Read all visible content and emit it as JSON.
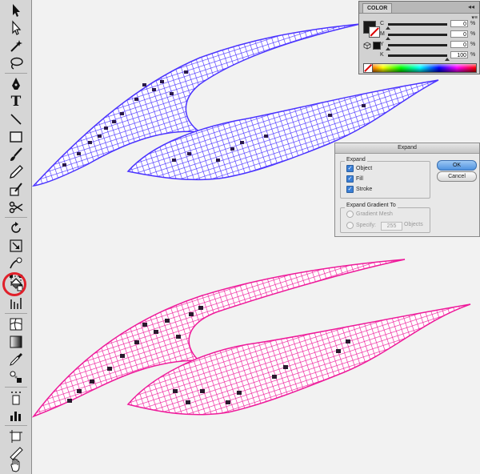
{
  "colors": {
    "mesh_top": "#4a33ff",
    "mesh_bottom": "#ee1a9a",
    "mesh_cell_dark": "#2a1a4a",
    "highlight_circle": "#e0202a"
  },
  "toolbar": {
    "active_tool": "live-paint-bucket",
    "tools": [
      {
        "name": "selection-tool",
        "icon": "arrow-icon"
      },
      {
        "name": "direct-selection-tool",
        "icon": "hollow-arrow-icon"
      },
      {
        "name": "magic-wand-tool",
        "icon": "wand-icon"
      },
      {
        "name": "lasso-tool",
        "icon": "lasso-icon"
      },
      {
        "name": "pen-tool",
        "icon": "pen-icon"
      },
      {
        "name": "type-tool",
        "icon": "type-icon",
        "glyph": "T"
      },
      {
        "name": "line-tool",
        "icon": "line-icon"
      },
      {
        "name": "rectangle-tool",
        "icon": "rectangle-icon"
      },
      {
        "name": "paintbrush-tool",
        "icon": "brush-icon"
      },
      {
        "name": "pencil-tool",
        "icon": "pencil-icon"
      },
      {
        "name": "blob-brush-tool",
        "icon": "blob-brush-icon"
      },
      {
        "name": "scissors-tool",
        "icon": "scissors-icon"
      },
      {
        "name": "rotate-tool",
        "icon": "rotate-icon"
      },
      {
        "name": "scale-tool",
        "icon": "scale-icon"
      },
      {
        "name": "warp-tool",
        "icon": "warp-icon"
      },
      {
        "name": "free-transform-tool",
        "icon": "free-transform-icon"
      },
      {
        "name": "live-paint-bucket-tool",
        "icon": "paint-bucket-icon"
      },
      {
        "name": "graph-tool",
        "icon": "graph-icon"
      },
      {
        "name": "mesh-tool",
        "icon": "mesh-icon"
      },
      {
        "name": "gradient-tool",
        "icon": "gradient-icon"
      },
      {
        "name": "eyedropper-tool",
        "icon": "eyedropper-icon"
      },
      {
        "name": "blend-tool",
        "icon": "blend-icon"
      },
      {
        "name": "symbol-sprayer-tool",
        "icon": "symbol-sprayer-icon"
      },
      {
        "name": "column-graph-tool",
        "icon": "column-graph-icon"
      },
      {
        "name": "artboard-tool",
        "icon": "artboard-icon"
      },
      {
        "name": "slice-tool",
        "icon": "slice-icon"
      },
      {
        "name": "hand-tool",
        "icon": "hand-icon"
      }
    ]
  },
  "color_panel": {
    "tab_label": "COLOR",
    "collapse_glyph": "◂◂",
    "menu_glyph": "▾≡",
    "rows": [
      {
        "label": "C",
        "value": "0",
        "unit": "%",
        "level": 0
      },
      {
        "label": "M",
        "value": "0",
        "unit": "%",
        "level": 0
      },
      {
        "label": "Y",
        "value": "0",
        "unit": "%",
        "level": 0
      },
      {
        "label": "K",
        "value": "100",
        "unit": "%",
        "level": 1
      }
    ]
  },
  "expand_dialog": {
    "title": "Expand",
    "expand_group_label": "Expand",
    "object_label": "Object",
    "fill_label": "Fill",
    "stroke_label": "Stroke",
    "object_checked": true,
    "fill_checked": true,
    "stroke_checked": true,
    "gradient_group_label": "Expand Gradient To",
    "gradient_mesh_label": "Gradient Mesh",
    "specify_label": "Specify:",
    "specify_value": "255",
    "objects_label": "Objects",
    "ok_label": "OK",
    "cancel_label": "Cancel"
  }
}
